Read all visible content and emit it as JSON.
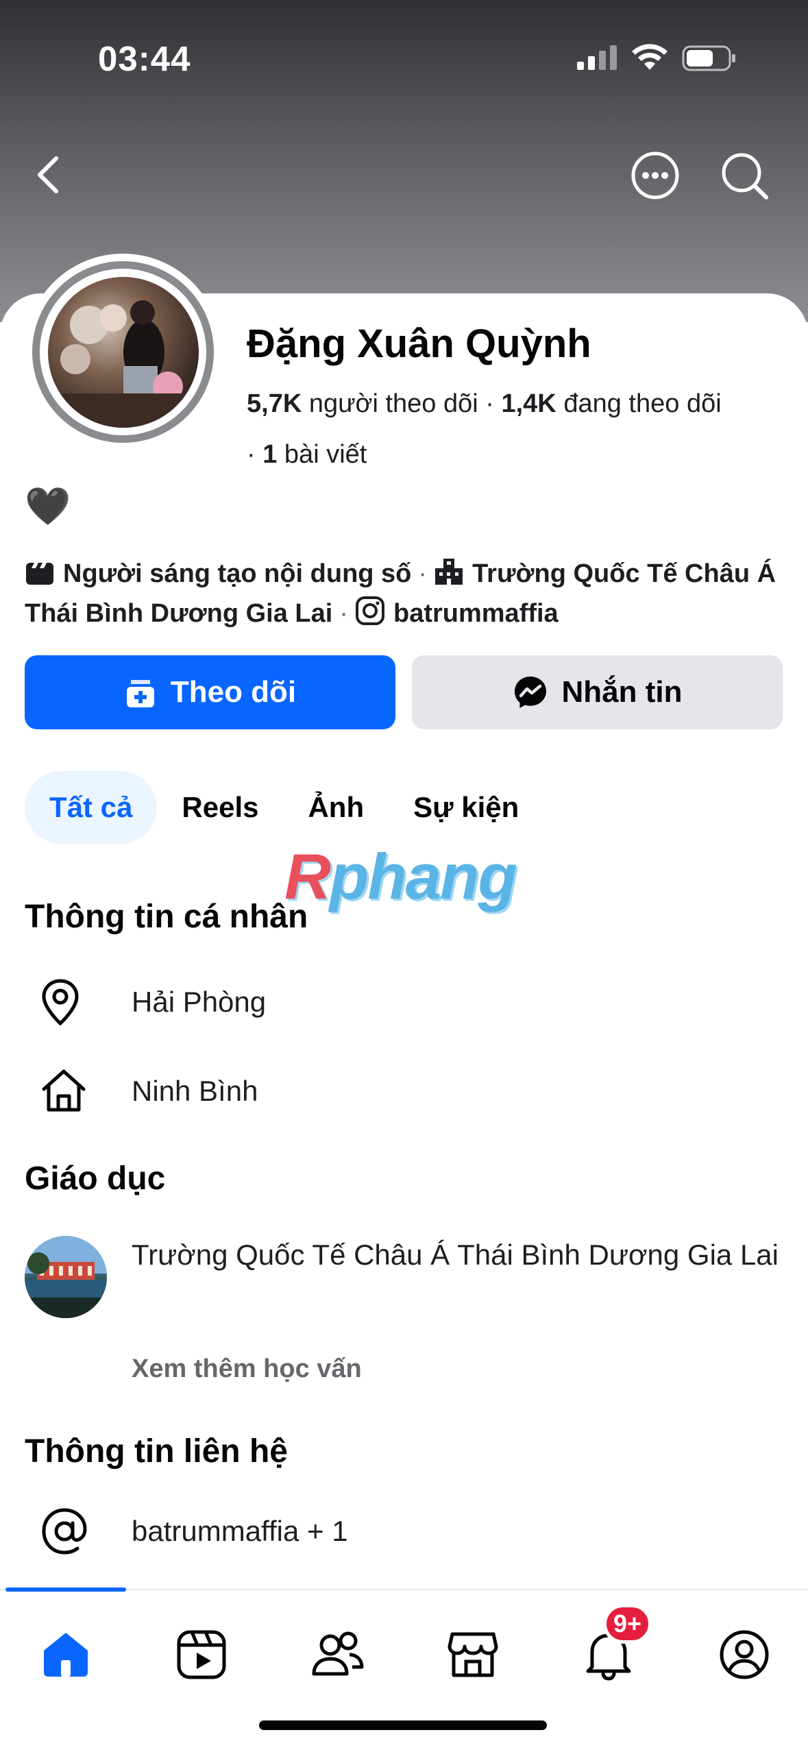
{
  "status_bar": {
    "time": "03:44"
  },
  "header": {
    "back_icon": "chevron-left-icon",
    "more_icon": "ellipsis-circle-icon",
    "search_icon": "search-icon"
  },
  "profile": {
    "name": "Đặng Xuân Quỳnh",
    "followers_count": "5,7K",
    "followers_label": "người theo dõi",
    "following_count": "1,4K",
    "following_label": "đang theo dõi",
    "posts_count": "1",
    "posts_label": "bài viết",
    "bio": "🖤"
  },
  "details": {
    "role": "Người sáng tạo nội dung số",
    "school": "Trường Quốc Tế Châu Á Thái Bình Dương Gia Lai",
    "instagram": "batrummaffia"
  },
  "actions": {
    "follow_label": "Theo dõi",
    "message_label": "Nhắn tin"
  },
  "tabs": [
    {
      "label": "Tất cả",
      "active": true
    },
    {
      "label": "Reels",
      "active": false
    },
    {
      "label": "Ảnh",
      "active": false
    },
    {
      "label": "Sự kiện",
      "active": false
    }
  ],
  "watermark": {
    "first": "R",
    "rest": "phang"
  },
  "personal_info": {
    "title": "Thông tin cá nhân",
    "current_city": "Hải Phòng",
    "hometown": "Ninh Bình"
  },
  "education": {
    "title": "Giáo dục",
    "school": "Trường Quốc Tế Châu Á Thái Bình Dương Gia Lai",
    "see_more": "Xem thêm học vấn"
  },
  "contact": {
    "title": "Thông tin liên hệ",
    "handle": "batrummaffia + 1"
  },
  "bottom_nav": {
    "items": [
      "home-icon",
      "reels-icon",
      "friends-icon",
      "marketplace-icon",
      "notifications-icon",
      "profile-icon"
    ],
    "notification_badge": "9+"
  },
  "colors": {
    "accent": "#0866ff",
    "secondary_button": "#e4e6eb",
    "badge": "#e41e3f"
  }
}
